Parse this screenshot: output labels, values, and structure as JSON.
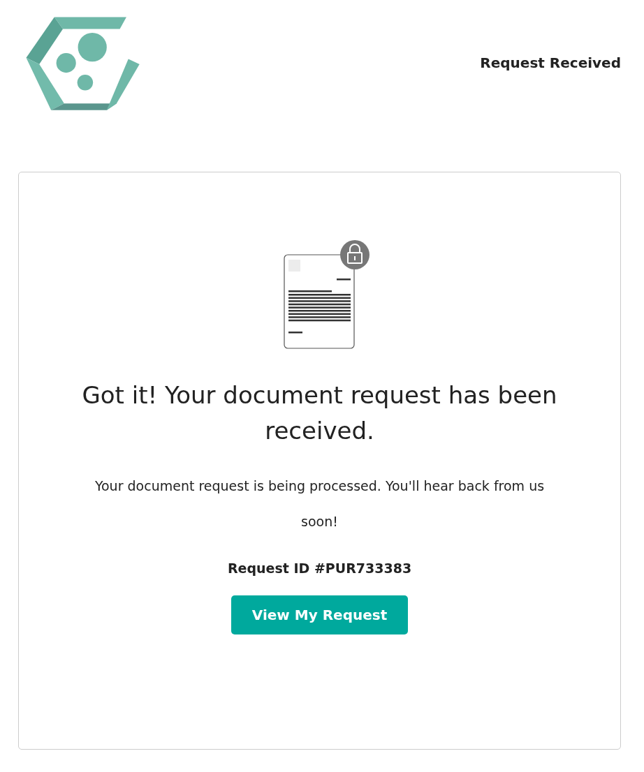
{
  "header": {
    "status": "Request Received"
  },
  "card": {
    "title": "Got it! Your document request has been received.",
    "message": "Your document request is being processed. You'll hear back from us soon!",
    "request_id": "Request ID #PUR733383",
    "button": "View My Request"
  }
}
